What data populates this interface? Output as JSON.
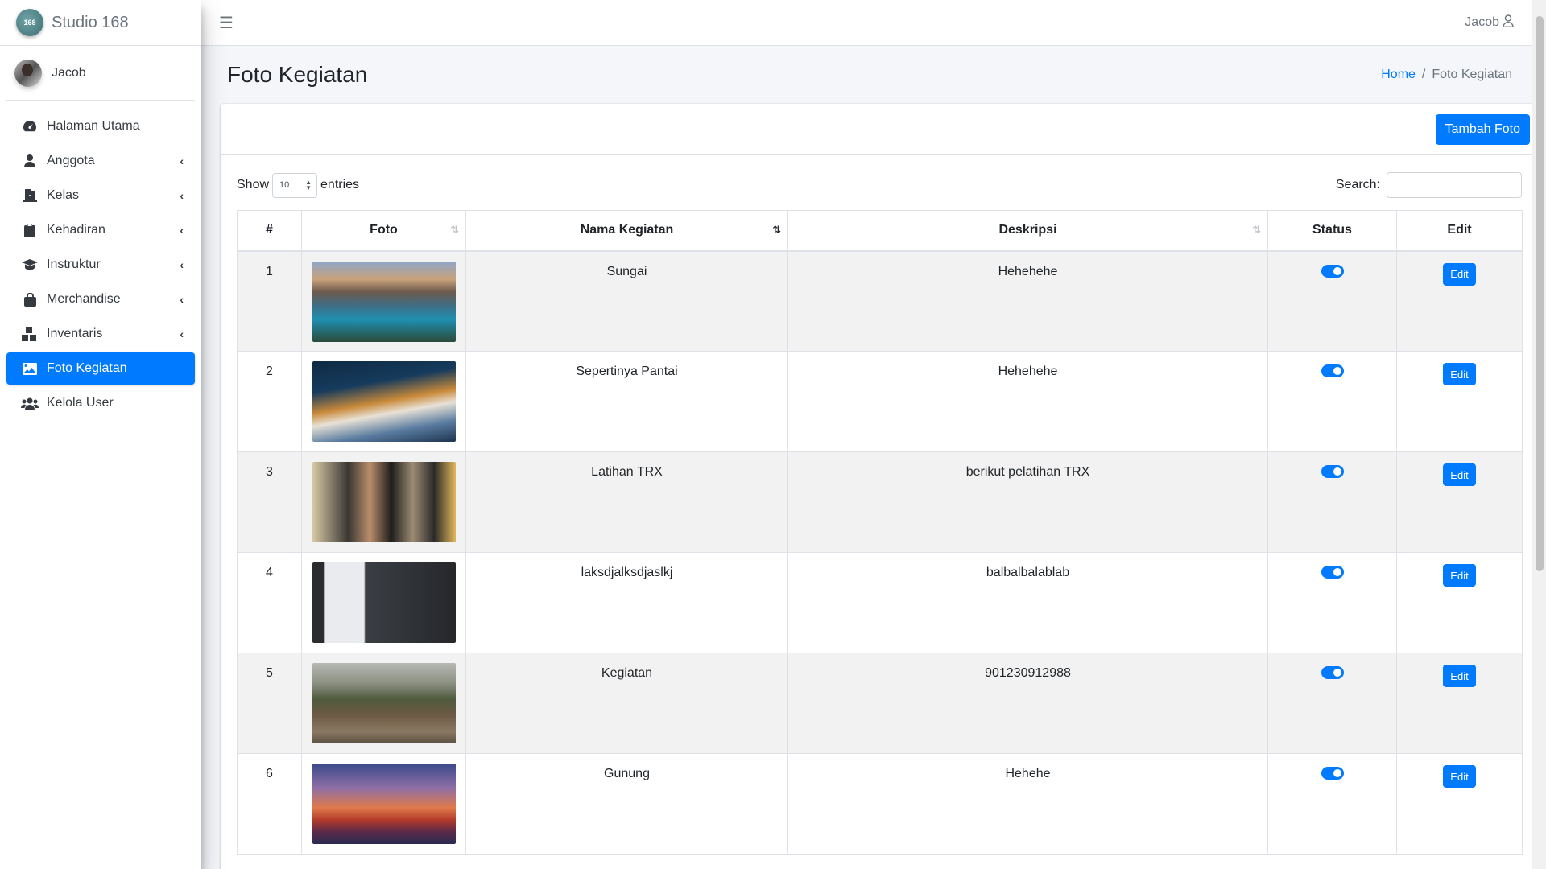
{
  "brand": {
    "logo_text": "168",
    "name": "Studio 168"
  },
  "user": {
    "name": "Jacob"
  },
  "sidebar": {
    "items": [
      {
        "label": "Halaman Utama",
        "icon": "dashboard-icon",
        "has_submenu": false,
        "active": false
      },
      {
        "label": "Anggota",
        "icon": "user-icon",
        "has_submenu": true,
        "active": false
      },
      {
        "label": "Kelas",
        "icon": "door-icon",
        "has_submenu": true,
        "active": false
      },
      {
        "label": "Kehadiran",
        "icon": "clipboard-icon",
        "has_submenu": true,
        "active": false
      },
      {
        "label": "Instruktur",
        "icon": "graduation-cap-icon",
        "has_submenu": true,
        "active": false
      },
      {
        "label": "Merchandise",
        "icon": "shopping-bag-icon",
        "has_submenu": true,
        "active": false
      },
      {
        "label": "Inventaris",
        "icon": "boxes-icon",
        "has_submenu": true,
        "active": false
      },
      {
        "label": "Foto Kegiatan",
        "icon": "image-icon",
        "has_submenu": false,
        "active": true
      },
      {
        "label": "Kelola User",
        "icon": "users-icon",
        "has_submenu": false,
        "active": false
      }
    ]
  },
  "navbar": {
    "user_label": "Jacob"
  },
  "page": {
    "title": "Foto Kegiatan",
    "breadcrumb": {
      "home": "Home",
      "separator": "/",
      "current": "Foto Kegiatan"
    }
  },
  "card": {
    "add_button": "Tambah Foto"
  },
  "datatable": {
    "show_label": "Show",
    "entries_value": "10",
    "entries_label": "entries",
    "search_label": "Search:",
    "search_value": "",
    "columns": [
      "#",
      "Foto",
      "Nama Kegiatan",
      "Deskripsi",
      "Status",
      "Edit"
    ],
    "rows": [
      {
        "no": "1",
        "nama": "Sungai",
        "deskripsi": "Hehehehe",
        "status": true,
        "edit": "Edit"
      },
      {
        "no": "2",
        "nama": "Sepertinya Pantai",
        "deskripsi": "Hehehehe",
        "status": true,
        "edit": "Edit"
      },
      {
        "no": "3",
        "nama": "Latihan TRX",
        "deskripsi": "berikut pelatihan TRX",
        "status": true,
        "edit": "Edit"
      },
      {
        "no": "4",
        "nama": "laksdjalksdjaslkj",
        "deskripsi": "balbalbalablab",
        "status": true,
        "edit": "Edit"
      },
      {
        "no": "5",
        "nama": "Kegiatan",
        "deskripsi": "901230912988",
        "status": true,
        "edit": "Edit"
      },
      {
        "no": "6",
        "nama": "Gunung",
        "deskripsi": "Hehehe",
        "status": true,
        "edit": "Edit"
      }
    ]
  },
  "colors": {
    "primary": "#007bff",
    "sidebar_bg": "#ffffff",
    "content_bg": "#f4f6f9",
    "row_stripe": "#f2f2f2"
  }
}
